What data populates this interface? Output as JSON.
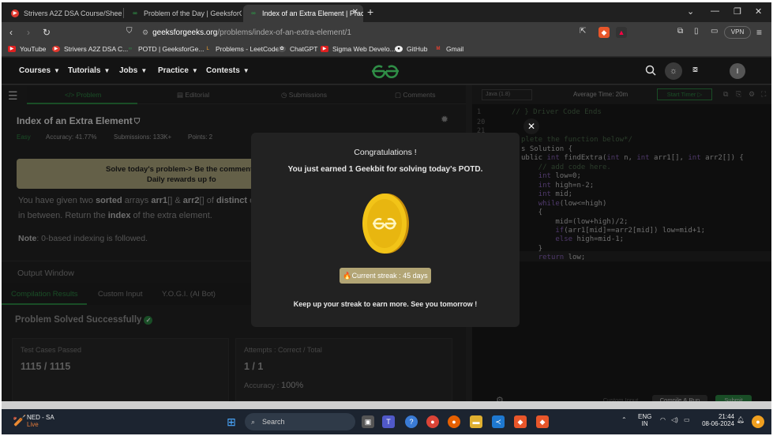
{
  "browser": {
    "tabs": [
      {
        "title": "Strivers A2Z DSA Course/Sheet - Cra",
        "active": false
      },
      {
        "title": "Problem of the Day | GeeksforGeeks",
        "active": false
      },
      {
        "title": "Index of an Extra Element | Prac",
        "active": true
      }
    ],
    "url_host": "geeksforgeeks.org",
    "url_path": "/problems/index-of-an-extra-element/1",
    "vpn_label": "VPN",
    "bookmarks": [
      "YouTube",
      "Strivers A2Z DSA C...",
      "POTD | GeeksforGe...",
      "Problems - LeetCode",
      "ChatGPT",
      "Sigma Web Develo...",
      "GitHub",
      "Gmail"
    ]
  },
  "site": {
    "menus": [
      "Courses",
      "Tutorials",
      "Jobs",
      "Practice",
      "Contests"
    ],
    "avatar_letter": "I"
  },
  "problem": {
    "tabs": [
      "</> Problem",
      "Editorial",
      "Submissions",
      "Comments"
    ],
    "title": "Index of an Extra Element",
    "difficulty": "Easy",
    "accuracy": "Accuracy: 41.77%",
    "submissions": "Submissions: 133K+",
    "points": "Points: 2",
    "banner_line1": "Solve today's problem-> Be the comment c",
    "banner_line2": "Daily rewards up fo",
    "desc_line1_a": "You have given two ",
    "desc_line1_b": "sorted",
    "desc_line1_c": " arrays ",
    "desc_line1_d": "arr1",
    "desc_line1_e": "[] & ",
    "desc_line1_f": "arr2",
    "desc_line1_g": "[] of ",
    "desc_line1_h": "distinct",
    "desc_line1_i": " ele",
    "desc_line2_a": "in between. Return the ",
    "desc_line2_b": "index",
    "desc_line2_c": " of the extra element.",
    "note_label": "Note",
    "note_text": ": 0-based indexing is followed."
  },
  "output": {
    "title": "Output Window",
    "tabs": [
      "Compilation Results",
      "Custom Input",
      "Y.O.G.I. (AI Bot)"
    ],
    "status": "Problem Solved Successfully",
    "tests_label": "Test Cases Passed",
    "tests_value": "1115 / 1115",
    "attempts_label": "Attempts : Correct / Total",
    "attempts_value": "1 / 1",
    "accuracy_label": "Accuracy : ",
    "accuracy_value": "100%"
  },
  "editor": {
    "language": "Java (1.8)",
    "avg_time": "Average Time: 20m",
    "timer_label": "Start Timer",
    "line_numbers": [
      "1",
      "20",
      "21"
    ],
    "code_lines": [
      "// } Driver Code Ends",
      "",
      "",
      "plete the function below*/",
      "s Solution {",
      "ublic int findExtra(int n, int arr1[], int arr2[]) {",
      "    // add code here.",
      "    int low=0;",
      "    int high=n-2;",
      "    int mid;",
      "    while(low<=high)",
      "    {",
      "        mid=(low+high)/2;",
      "        if(arr1[mid]==arr2[mid]) low=mid+1;",
      "        else high=mid-1;",
      "    }",
      "    return low;"
    ],
    "custom_input": "Custom Input",
    "compile_run": "Compile & Run",
    "submit": "Submit"
  },
  "modal": {
    "title": "Congratulations !",
    "message": "You just earned 1 Geekbit for solving today's POTD.",
    "streak": "Current streak : 45 days",
    "footer": "Keep up your streak to earn more. See you tomorrow !"
  },
  "taskbar": {
    "weather_title": "NED - SA",
    "weather_status": "Live",
    "search": "Search",
    "lang_top": "ENG",
    "lang_bottom": "IN",
    "time": "21:44",
    "date": "08-06-2024"
  },
  "colors": {
    "accent": "#2f8d46",
    "banner": "#b7b083",
    "streak": "#b2a575",
    "coin": "#f0c020"
  }
}
